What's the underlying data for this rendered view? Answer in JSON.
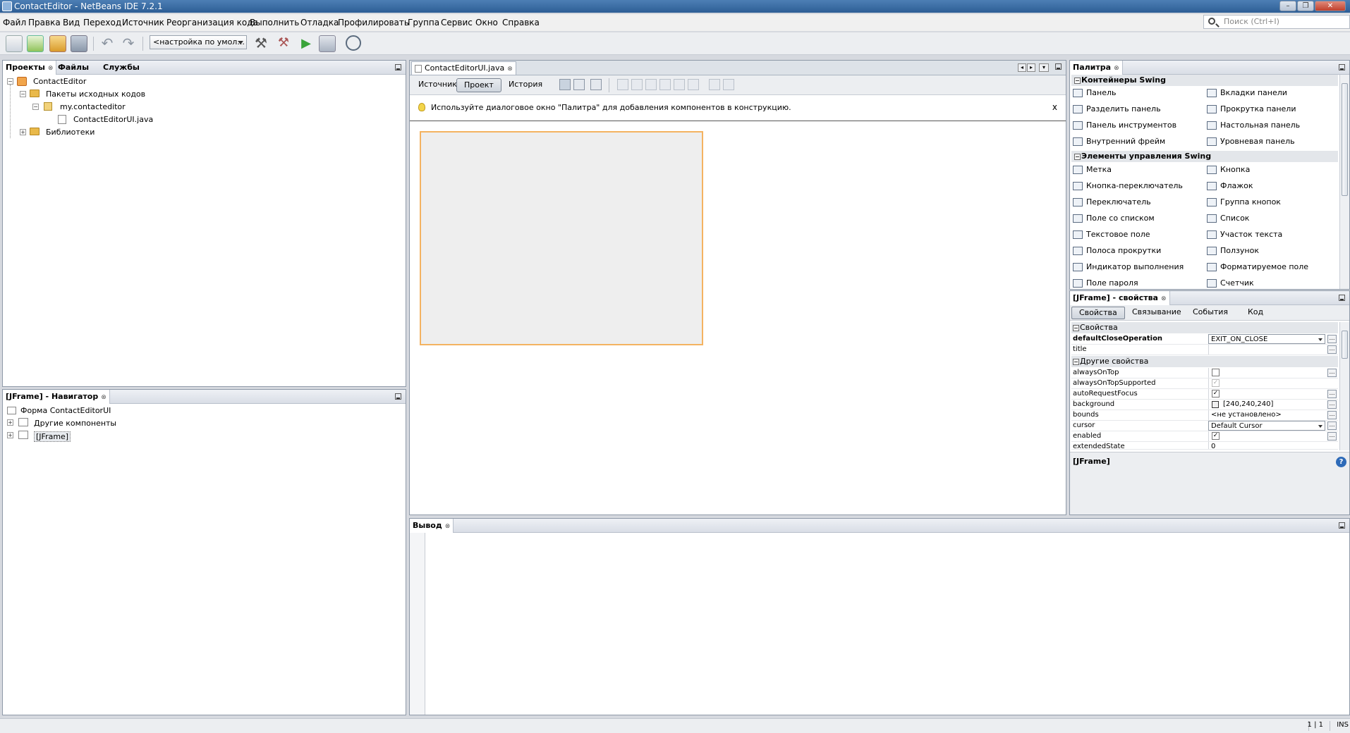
{
  "window": {
    "title": "ContactEditor - NetBeans IDE 7.2.1"
  },
  "menu": [
    "Файл",
    "Правка",
    "Вид",
    "Переход",
    "Источник",
    "Реорганизация кода",
    "Выполнить",
    "Отладка",
    "Профилировать",
    "Группа",
    "Сервис",
    "Окно",
    "Справка"
  ],
  "search": {
    "placeholder": "Поиск (Ctrl+I)"
  },
  "toolbar": {
    "config": "<настройка по умол...",
    "icons": [
      "new-file-icon",
      "new-project-icon",
      "open-project-icon",
      "save-all-icon",
      "undo-icon",
      "redo-icon",
      "build-icon",
      "clean-build-icon",
      "run-icon",
      "debug-icon",
      "profile-icon"
    ]
  },
  "projects_panel": {
    "tabs": [
      "Проекты",
      "Файлы",
      "Службы"
    ],
    "tree": [
      "ContactEditor",
      "Пакеты исходных кодов",
      "my.contacteditor",
      "ContactEditorUI.java",
      "Библиотеки"
    ]
  },
  "navigator": {
    "title": "[JFrame] - Навигатор",
    "tree": [
      "Форма ContactEditorUI",
      "Другие компоненты",
      "[JFrame]"
    ]
  },
  "editor": {
    "tab": "ContactEditorUI.java",
    "subtabs": [
      "Источник",
      "Проект",
      "История"
    ],
    "active_subtab": "Проект",
    "hint": "Используйте диалоговое окно \"Палитра\" для добавления компонентов в конструкцию.",
    "hint_close": "x"
  },
  "palette": {
    "title": "Палитра",
    "groups": [
      {
        "name": "Контейнеры Swing",
        "items": [
          "Панель",
          "Вкладки панели",
          "Разделить панель",
          "Прокрутка панели",
          "Панель инструментов",
          "Настольная панель",
          "Внутренний фрейм",
          "Уровневая панель"
        ]
      },
      {
        "name": "Элементы управления Swing",
        "items": [
          "Метка",
          "Кнопка",
          "Кнопка-переключатель",
          "Флажок",
          "Переключатель",
          "Группа кнопок",
          "Поле со списком",
          "Список",
          "Текстовое поле",
          "Участок текста",
          "Полоса прокрутки",
          "Ползунок",
          "Индикатор выполнения",
          "Форматируемое поле",
          "Поле пароля",
          "Счетчик"
        ]
      }
    ]
  },
  "properties": {
    "title": "[JFrame] - свойства",
    "tabs": [
      "Свойства",
      "Связывание",
      "События",
      "Код"
    ],
    "group1": "Свойства",
    "group2": "Другие свойства",
    "rows": [
      {
        "name": "defaultCloseOperation",
        "value": "EXIT_ON_CLOSE",
        "bold": true
      },
      {
        "name": "title",
        "value": ""
      },
      {
        "name": "alwaysOnTop",
        "value": ""
      },
      {
        "name": "alwaysOnTopSupported",
        "value": "✓"
      },
      {
        "name": "autoRequestFocus",
        "value": "✓"
      },
      {
        "name": "background",
        "value": "[240,240,240]"
      },
      {
        "name": "bounds",
        "value": "<не установлено>"
      },
      {
        "name": "cursor",
        "value": "Default Cursor"
      },
      {
        "name": "enabled",
        "value": "✓"
      },
      {
        "name": "extendedState",
        "value": "0"
      }
    ],
    "footer": "[JFrame]",
    "help": "?"
  },
  "output": {
    "title": "Вывод"
  },
  "status": {
    "position": "1 | 1",
    "mode": "INS"
  },
  "colors": {
    "accent": "#2d5e95",
    "form_border": "#f4b361"
  }
}
